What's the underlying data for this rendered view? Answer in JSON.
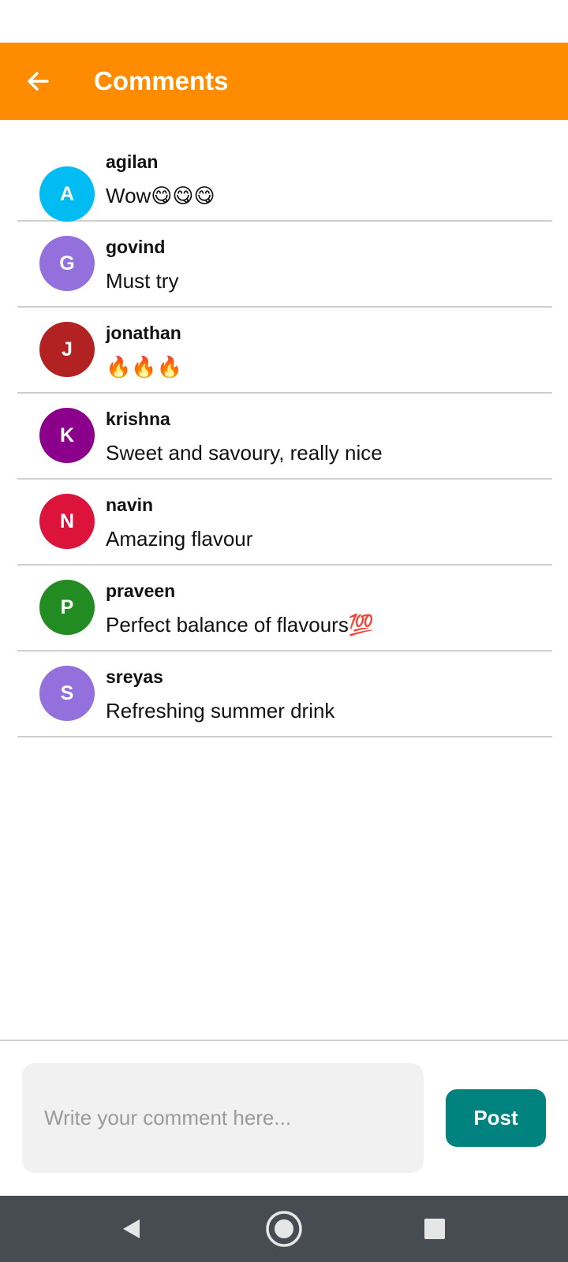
{
  "app_bar": {
    "title": "Comments",
    "back_icon": "arrow-left-icon",
    "background": "#ff8c00"
  },
  "comments": [
    {
      "initial": "A",
      "name": "agilan",
      "text": "Wow😋😋😋",
      "color": "#00bcf2"
    },
    {
      "initial": "G",
      "name": "govind",
      "text": "Must try",
      "color": "#9370db"
    },
    {
      "initial": "J",
      "name": "jonathan",
      "text": "🔥🔥🔥",
      "color": "#b22222"
    },
    {
      "initial": "K",
      "name": "krishna",
      "text": "Sweet and savoury, really nice",
      "color": "#8b008b"
    },
    {
      "initial": "N",
      "name": "navin",
      "text": "Amazing flavour",
      "color": "#dc143c"
    },
    {
      "initial": "P",
      "name": "praveen",
      "text": "Perfect balance of flavours💯",
      "color": "#228b22"
    },
    {
      "initial": "S",
      "name": "sreyas",
      "text": "Refreshing summer drink",
      "color": "#9370db"
    }
  ],
  "composer": {
    "placeholder": "Write your comment here...",
    "value": "",
    "post_label": "Post",
    "post_color": "#00837f"
  },
  "nav_bar": {
    "back_icon": "triangle-back-icon",
    "home_icon": "circle-home-icon",
    "recents_icon": "square-recents-icon"
  }
}
